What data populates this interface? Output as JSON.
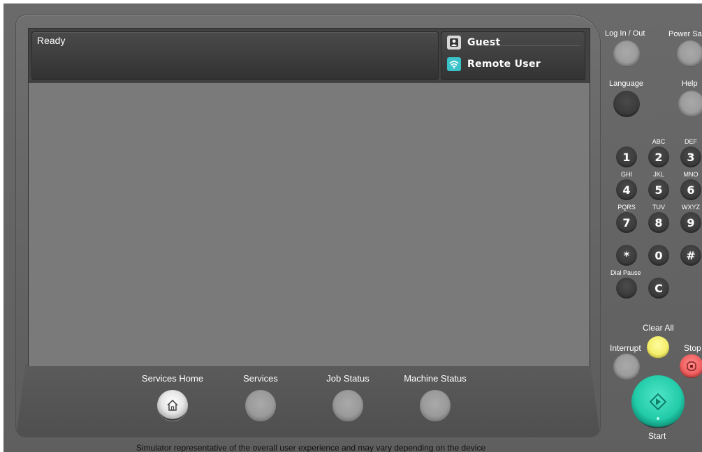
{
  "screen": {
    "message": "Ready",
    "users": [
      {
        "label": "Guest",
        "icon": "guest-user-icon"
      },
      {
        "label": "Remote User",
        "icon": "remote-wifi-icon"
      }
    ]
  },
  "bezel_buttons": {
    "services_home": "Services Home",
    "services": "Services",
    "job_status": "Job Status",
    "machine_status": "Machine Status"
  },
  "control_panel": {
    "log_in_out": "Log In / Out",
    "power_saver": "Power Sa",
    "language": "Language",
    "help": "Help",
    "dial_pause": "Dial Pause",
    "clear_all": "Clear All",
    "interrupt": "Interrupt",
    "stop": "Stop",
    "start": "Start",
    "keypad": {
      "k1": "1",
      "k2": "2",
      "k3": "3",
      "k4": "4",
      "k5": "5",
      "k6": "6",
      "k7": "7",
      "k8": "8",
      "k9": "9",
      "star": "*",
      "k0": "0",
      "hash": "#",
      "clear": "C",
      "s2": "ABC",
      "s3": "DEF",
      "s4": "GHI",
      "s5": "JKL",
      "s6": "MNO",
      "s7": "PQRS",
      "s8": "TUV",
      "s9": "WXYZ"
    }
  },
  "footer": "Simulator representative of the overall user experience and may vary depending on the device",
  "colors": {
    "start": "#22cba9",
    "clear_all": "#f4ee6a",
    "stop": "#f06060",
    "remote_icon": "#39c3c9"
  }
}
